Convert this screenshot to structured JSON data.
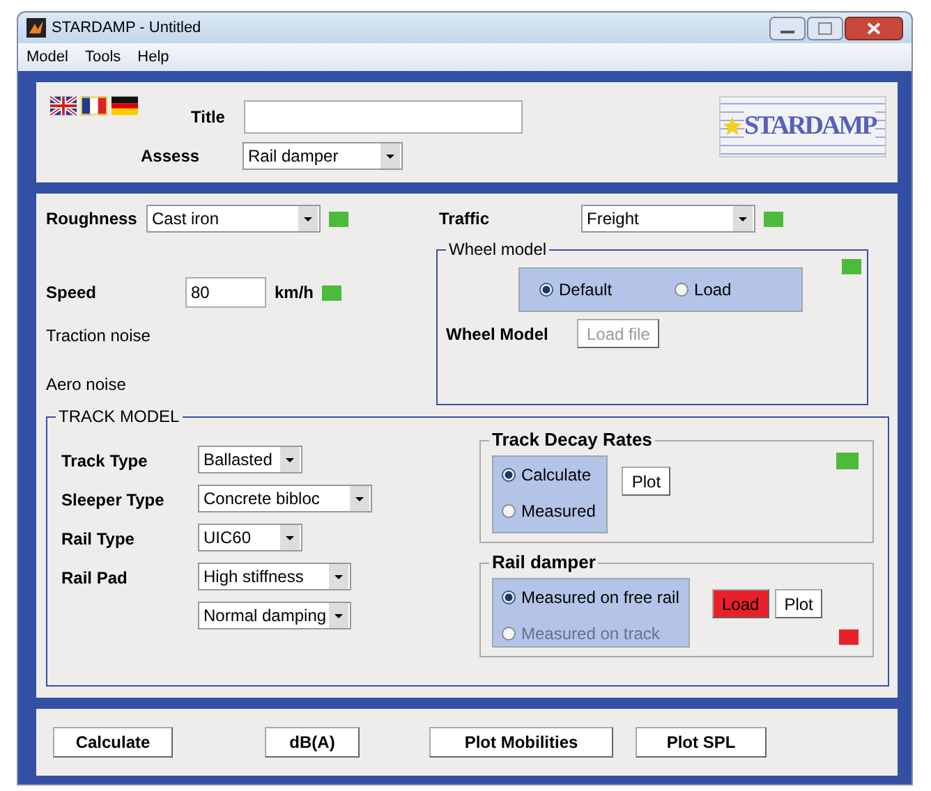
{
  "window": {
    "title": "STARDAMP - Untitled"
  },
  "menu": [
    {
      "label": "Model"
    },
    {
      "label": "Tools"
    },
    {
      "label": "Help"
    }
  ],
  "languages": [
    {
      "kind": "uk"
    },
    {
      "kind": "fr"
    },
    {
      "kind": "de"
    }
  ],
  "title_field": {
    "label": "Title"
  },
  "assess": {
    "label": "Assess",
    "value": "Rail damper"
  },
  "logo": {
    "text": "STARDAMP"
  },
  "roughness": {
    "label": "Roughness",
    "value": "Cast iron",
    "indicator": {
      "color": "#4cbb3c"
    }
  },
  "speed": {
    "label": "Speed",
    "value": "80",
    "unit": "km/h",
    "indicator": {
      "color": "#4cbb3c"
    }
  },
  "notes": [
    "Traction noise",
    "Aero noise"
  ],
  "traffic": {
    "label": "Traffic",
    "value": "Freight",
    "indicator": {
      "color": "#4cbb3c"
    }
  },
  "wheel_model": {
    "legend": "Wheel model",
    "indicator": {
      "color": "#4cbb3c"
    },
    "options": [
      {
        "label": "Default",
        "selected": true
      },
      {
        "label": "Load",
        "selected": false
      }
    ],
    "file_label": "Wheel Model",
    "file_button": {
      "label": "Load file",
      "disabled": true
    }
  },
  "track_model": {
    "legend": "TRACK MODEL",
    "params": [
      {
        "label": "Track Type",
        "values": [
          "Ballasted"
        ]
      },
      {
        "label": "Sleeper Type",
        "values": [
          "Concrete bibloc"
        ]
      },
      {
        "label": "Rail Type",
        "values": [
          "UIC60"
        ]
      },
      {
        "label": "Rail Pad",
        "values": [
          "High stiffness",
          "Normal damping"
        ]
      }
    ],
    "decay_rates": {
      "legend": "Track Decay Rates",
      "indicator": {
        "color": "#4cbb3c"
      },
      "options": [
        {
          "label": "Calculate",
          "selected": true,
          "disabled": false
        },
        {
          "label": "Measured",
          "selected": false,
          "disabled": false
        }
      ],
      "buttons": [
        {
          "label": "Plot"
        }
      ]
    },
    "rail_damper": {
      "legend": "Rail damper",
      "indicator": {
        "color": "#e8202a"
      },
      "options": [
        {
          "label": "Measured on free rail",
          "selected": true,
          "disabled": false
        },
        {
          "label": "Measured on track",
          "selected": false,
          "disabled": true
        }
      ],
      "buttons": [
        {
          "label": "Load",
          "color": "#e8202a"
        },
        {
          "label": "Plot"
        }
      ]
    }
  },
  "actions": [
    {
      "label": "Calculate"
    },
    {
      "label": "dB(A)"
    },
    {
      "label": "Plot Mobilities"
    },
    {
      "label": "Plot SPL"
    }
  ]
}
